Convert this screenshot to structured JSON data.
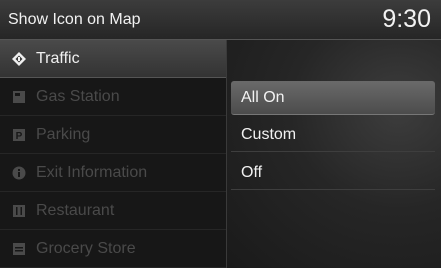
{
  "header": {
    "title": "Show Icon on Map",
    "time": "9:30"
  },
  "categories": [
    {
      "label": "Traffic",
      "icon": "traffic-icon"
    },
    {
      "label": "Gas Station",
      "icon": "gas-station-icon"
    },
    {
      "label": "Parking",
      "icon": "parking-icon"
    },
    {
      "label": "Exit Information",
      "icon": "info-icon"
    },
    {
      "label": "Restaurant",
      "icon": "restaurant-icon"
    },
    {
      "label": "Grocery Store",
      "icon": "grocery-icon"
    }
  ],
  "options": [
    {
      "label": "All On"
    },
    {
      "label": "Custom"
    },
    {
      "label": "Off"
    }
  ],
  "colors": {
    "highlight": "#5a5a5a",
    "text": "#f2f2f2",
    "disabled_text": "#4a4a4a"
  }
}
